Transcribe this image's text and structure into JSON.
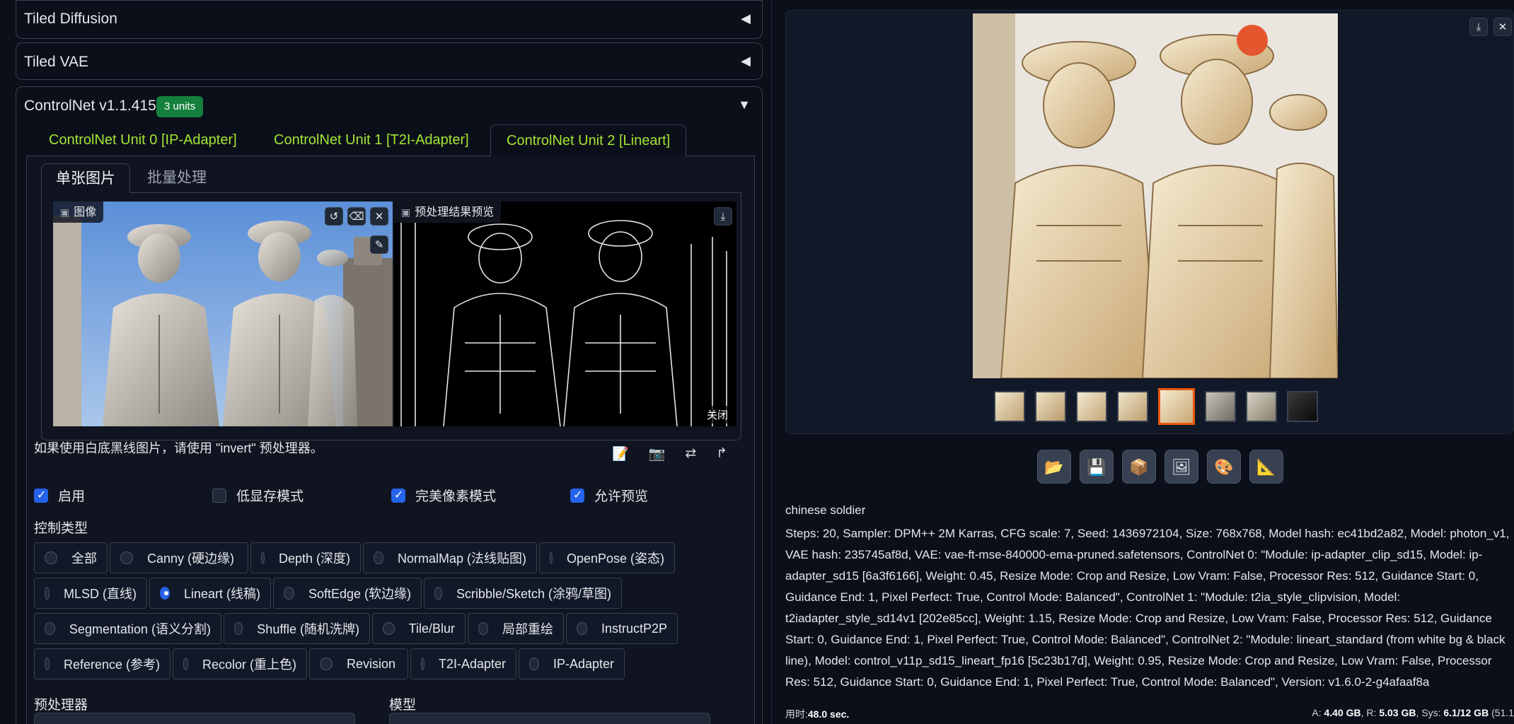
{
  "accordions": {
    "tiled_diffusion": {
      "title": "Tiled Diffusion",
      "arrow": "◀"
    },
    "tiled_vae": {
      "title": "Tiled VAE",
      "arrow": "◀"
    },
    "controlnet": {
      "title": "ControlNet v1.1.415",
      "badge": "3 units",
      "arrow": "▼"
    }
  },
  "unit_tabs": [
    {
      "label": "ControlNet Unit 0 [IP-Adapter]"
    },
    {
      "label": "ControlNet Unit 1 [T2I-Adapter]"
    },
    {
      "label": "ControlNet Unit 2 [Lineart]",
      "active": true
    }
  ],
  "sub_tabs": [
    {
      "label": "单张图片",
      "active": true
    },
    {
      "label": "批量处理"
    }
  ],
  "image_panes": {
    "input_label": "图像",
    "preview_label": "预处理结果预览",
    "close_label": "关闭"
  },
  "hint": "如果使用白底黑线图片，请使用 \"invert\" 预处理器。",
  "checkboxes": [
    {
      "label": "启用",
      "checked": true
    },
    {
      "label": "低显存模式",
      "checked": false
    },
    {
      "label": "完美像素模式",
      "checked": true
    },
    {
      "label": "允许预览",
      "checked": true
    }
  ],
  "control_type_label": "控制类型",
  "control_types": [
    [
      "全部",
      "Canny (硬边缘)",
      "Depth (深度)",
      "NormalMap (法线贴图)",
      "OpenPose (姿态)"
    ],
    [
      "MLSD (直线)",
      "Lineart (线稿)",
      "SoftEdge (软边缘)",
      "Scribble/Sketch (涂鸦/草图)"
    ],
    [
      "Segmentation (语义分割)",
      "Shuffle (随机洗牌)",
      "Tile/Blur",
      "局部重绘",
      "InstructP2P"
    ],
    [
      "Reference (参考)",
      "Recolor (重上色)",
      "Revision",
      "T2I-Adapter",
      "IP-Adapter"
    ]
  ],
  "selected_control_type": "Lineart (线稿)",
  "preprocessor_label": "预处理器",
  "model_label": "模型",
  "output": {
    "prompt": "chinese soldier",
    "params": "Steps: 20, Sampler: DPM++ 2M Karras, CFG scale: 7, Seed: 1436972104, Size: 768x768, Model hash: ec41bd2a82, Model: photon_v1, VAE hash: 235745af8d, VAE: vae-ft-mse-840000-ema-pruned.safetensors, ControlNet 0: \"Module: ip-adapter_clip_sd15, Model: ip-adapter_sd15 [6a3f6166], Weight: 0.45, Resize Mode: Crop and Resize, Low Vram: False, Processor Res: 512, Guidance Start: 0, Guidance End: 1, Pixel Perfect: True, Control Mode: Balanced\", ControlNet 1: \"Module: t2ia_style_clipvision, Model: t2iadapter_style_sd14v1 [202e85cc], Weight: 1.15, Resize Mode: Crop and Resize, Low Vram: False, Processor Res: 512, Guidance Start: 0, Guidance End: 1, Pixel Perfect: True, Control Mode: Balanced\", ControlNet 2: \"Module: lineart_standard (from white bg & black line), Model: control_v11p_sd15_lineart_fp16 [5c23b17d], Weight: 0.95, Resize Mode: Crop and Resize, Low Vram: False, Processor Res: 512, Guidance Start: 0, Guidance End: 1, Pixel Perfect: True, Control Mode: Balanced\", Version: v1.6.0-2-g4afaaf8a",
    "time_label": "用时:",
    "time_value": "48.0 sec.",
    "mem_a_label": "A: ",
    "mem_a": "4.40 GB",
    "mem_r_label": ", R: ",
    "mem_r": "5.03 GB",
    "mem_sys_label": ", Sys: ",
    "mem_sys": "6.1/12 GB",
    "mem_pct": " (51.1"
  },
  "gallery": {
    "thumb_count": 8,
    "active_thumb": 4
  },
  "icons": {
    "folder": "📂",
    "save": "💾",
    "zip": "📦",
    "image": "🖼",
    "palette": "🎨",
    "ruler": "📐"
  }
}
